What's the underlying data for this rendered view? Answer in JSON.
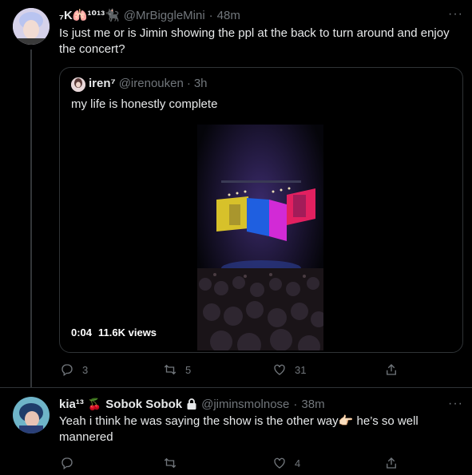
{
  "tweet1": {
    "display_name": "₇K🫁¹⁰¹³🐈‍⬛",
    "handle": "@MrBiggleMini",
    "time": "48m",
    "text_line1": "Is just me or is Jimin showing the ppl at the back to turn around and enjoy",
    "text_line2": "the concert?",
    "more_label": "···",
    "quote": {
      "display_name": "iren⁷",
      "handle": "@irenouken",
      "time": "3h",
      "text": "my life is honestly complete",
      "video_time": "0:04",
      "video_views": "11.6K views"
    },
    "actions": {
      "replies": "3",
      "retweets": "5",
      "likes": "31"
    }
  },
  "tweet2": {
    "display_name": "kia¹³",
    "cherry": "🍒",
    "display_name2": "Sobok Sobok",
    "handle": "@jiminsmolnose",
    "time": "38m",
    "text_line1": "Yeah i think he was saying the show is the other way👉🏻 he’s so well",
    "text_line2": "mannered",
    "more_label": "···",
    "actions": {
      "replies": "",
      "retweets": "",
      "likes": "4"
    }
  },
  "colors": {
    "bg": "#000000",
    "text": "#e7e9ea",
    "muted": "#71767b",
    "border": "#2f3336"
  }
}
